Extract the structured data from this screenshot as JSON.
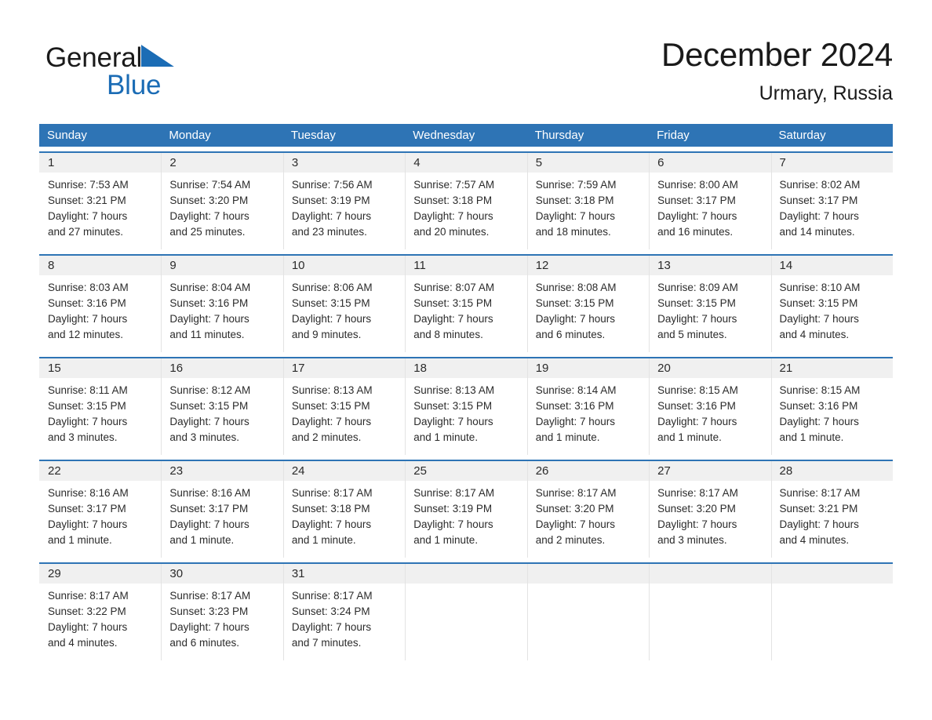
{
  "brand": {
    "name_part1": "General",
    "name_part2": "Blue",
    "logo_icon": "triangle-flag-icon",
    "color_blue": "#1b6cb5"
  },
  "header": {
    "title": "December 2024",
    "subtitle": "Urmary, Russia"
  },
  "theme": {
    "header_blue": "#2e74b5",
    "daynum_band": "#f0f0f0",
    "text": "#2b2b2b"
  },
  "calendar": {
    "weekday_headers": [
      "Sunday",
      "Monday",
      "Tuesday",
      "Wednesday",
      "Thursday",
      "Friday",
      "Saturday"
    ],
    "weeks": [
      [
        {
          "day": "1",
          "sunrise": "Sunrise: 7:53 AM",
          "sunset": "Sunset: 3:21 PM",
          "daylight1": "Daylight: 7 hours",
          "daylight2": "and 27 minutes."
        },
        {
          "day": "2",
          "sunrise": "Sunrise: 7:54 AM",
          "sunset": "Sunset: 3:20 PM",
          "daylight1": "Daylight: 7 hours",
          "daylight2": "and 25 minutes."
        },
        {
          "day": "3",
          "sunrise": "Sunrise: 7:56 AM",
          "sunset": "Sunset: 3:19 PM",
          "daylight1": "Daylight: 7 hours",
          "daylight2": "and 23 minutes."
        },
        {
          "day": "4",
          "sunrise": "Sunrise: 7:57 AM",
          "sunset": "Sunset: 3:18 PM",
          "daylight1": "Daylight: 7 hours",
          "daylight2": "and 20 minutes."
        },
        {
          "day": "5",
          "sunrise": "Sunrise: 7:59 AM",
          "sunset": "Sunset: 3:18 PM",
          "daylight1": "Daylight: 7 hours",
          "daylight2": "and 18 minutes."
        },
        {
          "day": "6",
          "sunrise": "Sunrise: 8:00 AM",
          "sunset": "Sunset: 3:17 PM",
          "daylight1": "Daylight: 7 hours",
          "daylight2": "and 16 minutes."
        },
        {
          "day": "7",
          "sunrise": "Sunrise: 8:02 AM",
          "sunset": "Sunset: 3:17 PM",
          "daylight1": "Daylight: 7 hours",
          "daylight2": "and 14 minutes."
        }
      ],
      [
        {
          "day": "8",
          "sunrise": "Sunrise: 8:03 AM",
          "sunset": "Sunset: 3:16 PM",
          "daylight1": "Daylight: 7 hours",
          "daylight2": "and 12 minutes."
        },
        {
          "day": "9",
          "sunrise": "Sunrise: 8:04 AM",
          "sunset": "Sunset: 3:16 PM",
          "daylight1": "Daylight: 7 hours",
          "daylight2": "and 11 minutes."
        },
        {
          "day": "10",
          "sunrise": "Sunrise: 8:06 AM",
          "sunset": "Sunset: 3:15 PM",
          "daylight1": "Daylight: 7 hours",
          "daylight2": "and 9 minutes."
        },
        {
          "day": "11",
          "sunrise": "Sunrise: 8:07 AM",
          "sunset": "Sunset: 3:15 PM",
          "daylight1": "Daylight: 7 hours",
          "daylight2": "and 8 minutes."
        },
        {
          "day": "12",
          "sunrise": "Sunrise: 8:08 AM",
          "sunset": "Sunset: 3:15 PM",
          "daylight1": "Daylight: 7 hours",
          "daylight2": "and 6 minutes."
        },
        {
          "day": "13",
          "sunrise": "Sunrise: 8:09 AM",
          "sunset": "Sunset: 3:15 PM",
          "daylight1": "Daylight: 7 hours",
          "daylight2": "and 5 minutes."
        },
        {
          "day": "14",
          "sunrise": "Sunrise: 8:10 AM",
          "sunset": "Sunset: 3:15 PM",
          "daylight1": "Daylight: 7 hours",
          "daylight2": "and 4 minutes."
        }
      ],
      [
        {
          "day": "15",
          "sunrise": "Sunrise: 8:11 AM",
          "sunset": "Sunset: 3:15 PM",
          "daylight1": "Daylight: 7 hours",
          "daylight2": "and 3 minutes."
        },
        {
          "day": "16",
          "sunrise": "Sunrise: 8:12 AM",
          "sunset": "Sunset: 3:15 PM",
          "daylight1": "Daylight: 7 hours",
          "daylight2": "and 3 minutes."
        },
        {
          "day": "17",
          "sunrise": "Sunrise: 8:13 AM",
          "sunset": "Sunset: 3:15 PM",
          "daylight1": "Daylight: 7 hours",
          "daylight2": "and 2 minutes."
        },
        {
          "day": "18",
          "sunrise": "Sunrise: 8:13 AM",
          "sunset": "Sunset: 3:15 PM",
          "daylight1": "Daylight: 7 hours",
          "daylight2": "and 1 minute."
        },
        {
          "day": "19",
          "sunrise": "Sunrise: 8:14 AM",
          "sunset": "Sunset: 3:16 PM",
          "daylight1": "Daylight: 7 hours",
          "daylight2": "and 1 minute."
        },
        {
          "day": "20",
          "sunrise": "Sunrise: 8:15 AM",
          "sunset": "Sunset: 3:16 PM",
          "daylight1": "Daylight: 7 hours",
          "daylight2": "and 1 minute."
        },
        {
          "day": "21",
          "sunrise": "Sunrise: 8:15 AM",
          "sunset": "Sunset: 3:16 PM",
          "daylight1": "Daylight: 7 hours",
          "daylight2": "and 1 minute."
        }
      ],
      [
        {
          "day": "22",
          "sunrise": "Sunrise: 8:16 AM",
          "sunset": "Sunset: 3:17 PM",
          "daylight1": "Daylight: 7 hours",
          "daylight2": "and 1 minute."
        },
        {
          "day": "23",
          "sunrise": "Sunrise: 8:16 AM",
          "sunset": "Sunset: 3:17 PM",
          "daylight1": "Daylight: 7 hours",
          "daylight2": "and 1 minute."
        },
        {
          "day": "24",
          "sunrise": "Sunrise: 8:17 AM",
          "sunset": "Sunset: 3:18 PM",
          "daylight1": "Daylight: 7 hours",
          "daylight2": "and 1 minute."
        },
        {
          "day": "25",
          "sunrise": "Sunrise: 8:17 AM",
          "sunset": "Sunset: 3:19 PM",
          "daylight1": "Daylight: 7 hours",
          "daylight2": "and 1 minute."
        },
        {
          "day": "26",
          "sunrise": "Sunrise: 8:17 AM",
          "sunset": "Sunset: 3:20 PM",
          "daylight1": "Daylight: 7 hours",
          "daylight2": "and 2 minutes."
        },
        {
          "day": "27",
          "sunrise": "Sunrise: 8:17 AM",
          "sunset": "Sunset: 3:20 PM",
          "daylight1": "Daylight: 7 hours",
          "daylight2": "and 3 minutes."
        },
        {
          "day": "28",
          "sunrise": "Sunrise: 8:17 AM",
          "sunset": "Sunset: 3:21 PM",
          "daylight1": "Daylight: 7 hours",
          "daylight2": "and 4 minutes."
        }
      ],
      [
        {
          "day": "29",
          "sunrise": "Sunrise: 8:17 AM",
          "sunset": "Sunset: 3:22 PM",
          "daylight1": "Daylight: 7 hours",
          "daylight2": "and 4 minutes."
        },
        {
          "day": "30",
          "sunrise": "Sunrise: 8:17 AM",
          "sunset": "Sunset: 3:23 PM",
          "daylight1": "Daylight: 7 hours",
          "daylight2": "and 6 minutes."
        },
        {
          "day": "31",
          "sunrise": "Sunrise: 8:17 AM",
          "sunset": "Sunset: 3:24 PM",
          "daylight1": "Daylight: 7 hours",
          "daylight2": "and 7 minutes."
        },
        {
          "day": "",
          "sunrise": "",
          "sunset": "",
          "daylight1": "",
          "daylight2": ""
        },
        {
          "day": "",
          "sunrise": "",
          "sunset": "",
          "daylight1": "",
          "daylight2": ""
        },
        {
          "day": "",
          "sunrise": "",
          "sunset": "",
          "daylight1": "",
          "daylight2": ""
        },
        {
          "day": "",
          "sunrise": "",
          "sunset": "",
          "daylight1": "",
          "daylight2": ""
        }
      ]
    ]
  }
}
